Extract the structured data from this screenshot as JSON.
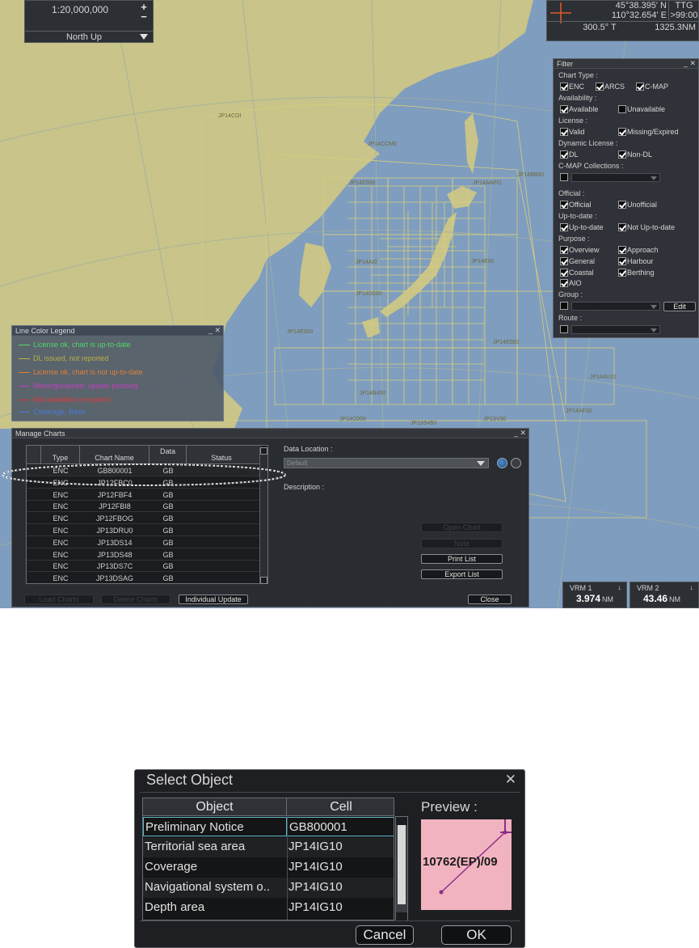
{
  "scale_panel": {
    "scale": "1:20,000,000",
    "plus": "+",
    "minus": "−",
    "orientation": "North Up"
  },
  "position_panel": {
    "lat": "45°38.395' N",
    "lon": "110°32.654' E",
    "ttg_label": "TTG",
    "ttg_value": ">99:00",
    "bearing": "300.5° T",
    "distance": "1325.3NM"
  },
  "map": {
    "chart_labels": [
      "JP14COI",
      "JP14CCM8",
      "JP14E000",
      "JP14AAPO",
      "JP14BB00",
      "JP14E00",
      "JP14AI0",
      "JP14D200",
      "JP14E000",
      "JP14E000",
      "JP14B400",
      "JP14C000",
      "JP14AV10",
      "JP14AF30",
      "JP13S450",
      "JP13V30"
    ],
    "colors": {
      "sea": "#7f9dbf",
      "land": "#c8c48a",
      "grid": "#d6cf7a"
    }
  },
  "filter": {
    "title": "Filter",
    "controls": "_ ✕",
    "chart_type_label": "Chart Type :",
    "chart_types": [
      {
        "label": "ENC",
        "checked": true
      },
      {
        "label": "ARCS",
        "checked": true
      },
      {
        "label": "C-MAP",
        "checked": true
      }
    ],
    "availability_label": "Availability :",
    "availability": [
      {
        "label": "Available",
        "checked": true
      },
      {
        "label": "Unavailable",
        "checked": false
      }
    ],
    "license_label": "License :",
    "license": [
      {
        "label": "Valid",
        "checked": true
      },
      {
        "label": "Missing/Expired",
        "checked": true
      }
    ],
    "dynamic_license_label": "Dynamic License :",
    "dynamic_license": [
      {
        "label": "DL",
        "checked": true
      },
      {
        "label": "Non-DL",
        "checked": true
      }
    ],
    "cmap_collections_label": "C-MAP Collections :",
    "official_label": "Official :",
    "official": [
      {
        "label": "Official",
        "checked": true
      },
      {
        "label": "Unofficial",
        "checked": true
      }
    ],
    "uptodate_label": "Up-to-date :",
    "uptodate": [
      {
        "label": "Up-to-date",
        "checked": true
      },
      {
        "label": "Not Up-to-date",
        "checked": true
      }
    ],
    "purpose_label": "Purpose :",
    "purpose": [
      {
        "label": "Overview",
        "checked": true
      },
      {
        "label": "Approach",
        "checked": true
      },
      {
        "label": "General",
        "checked": true
      },
      {
        "label": "Harbour",
        "checked": true
      },
      {
        "label": "Coastal",
        "checked": true
      },
      {
        "label": "Berthing",
        "checked": true
      },
      {
        "label": "AIO",
        "checked": true
      }
    ],
    "group_label": "Group :",
    "edit_label": "Edit",
    "route_label": "Route :"
  },
  "legend": {
    "title": "Line Color Legend",
    "controls": "_ ✕",
    "items": [
      {
        "label": "License ok, chart is up-to-date",
        "color": "#4fd86a"
      },
      {
        "label": "DL issued, not reported",
        "color": "#b9b04a"
      },
      {
        "label": "License ok, chart is not up-to-date",
        "color": "#e0803a"
      },
      {
        "label": "Missing/expired, update pending",
        "color": "#c040c0"
      },
      {
        "label": "Not available or expired",
        "color": "#e03a3a"
      },
      {
        "label": "Coverage, Base",
        "color": "#4a7ad8"
      }
    ]
  },
  "manage": {
    "title": "Manage Charts",
    "controls": "_ ✕",
    "headers": {
      "type": "Type",
      "name": "Chart Name",
      "data": "Data",
      "status": "Status"
    },
    "rows": [
      {
        "type": "ENC",
        "name": "GB800001",
        "data": "GB",
        "status": ""
      },
      {
        "type": "ENC",
        "name": "JP12FBC0",
        "data": "GB",
        "status": ""
      },
      {
        "type": "ENC",
        "name": "JP12FBF4",
        "data": "GB",
        "status": ""
      },
      {
        "type": "ENC",
        "name": "JP12FBI8",
        "data": "GB",
        "status": ""
      },
      {
        "type": "ENC",
        "name": "JP12FBOG",
        "data": "GB",
        "status": ""
      },
      {
        "type": "ENC",
        "name": "JP13DRU0",
        "data": "GB",
        "status": ""
      },
      {
        "type": "ENC",
        "name": "JP13DS14",
        "data": "GB",
        "status": ""
      },
      {
        "type": "ENC",
        "name": "JP13DS48",
        "data": "GB",
        "status": ""
      },
      {
        "type": "ENC",
        "name": "JP13DS7C",
        "data": "GB",
        "status": ""
      },
      {
        "type": "ENC",
        "name": "JP13DSAG",
        "data": "GB",
        "status": ""
      }
    ],
    "data_location_label": "Data Location :",
    "data_location_value": "Default",
    "description_label": "Description :",
    "open_chart": "Open Chart",
    "note": "Note",
    "print_list": "Print List",
    "export_list": "Export List",
    "load_charts": "Load Charts",
    "delete_charts": "Delete Charts",
    "individual_update": "Individual Update",
    "close": "Close"
  },
  "vrm1": {
    "label": "VRM 1",
    "value": "3.974",
    "unit": "NM"
  },
  "vrm2": {
    "label": "VRM 2",
    "value": "43.46",
    "unit": "NM"
  },
  "select_object": {
    "title": "Select Object",
    "close": "✕",
    "headers": {
      "object": "Object",
      "cell": "Cell"
    },
    "rows": [
      {
        "object": "Preliminary Notice",
        "cell": "GB800001"
      },
      {
        "object": "Territorial sea area",
        "cell": "JP14IG10"
      },
      {
        "object": "Coverage",
        "cell": "JP14IG10"
      },
      {
        "object": "Navigational system o..",
        "cell": "JP14IG10"
      },
      {
        "object": "Depth area",
        "cell": "JP14IG10"
      }
    ],
    "preview_label": "Preview :",
    "preview_text": "10762(EP)/09",
    "cancel": "Cancel",
    "ok": "OK"
  }
}
